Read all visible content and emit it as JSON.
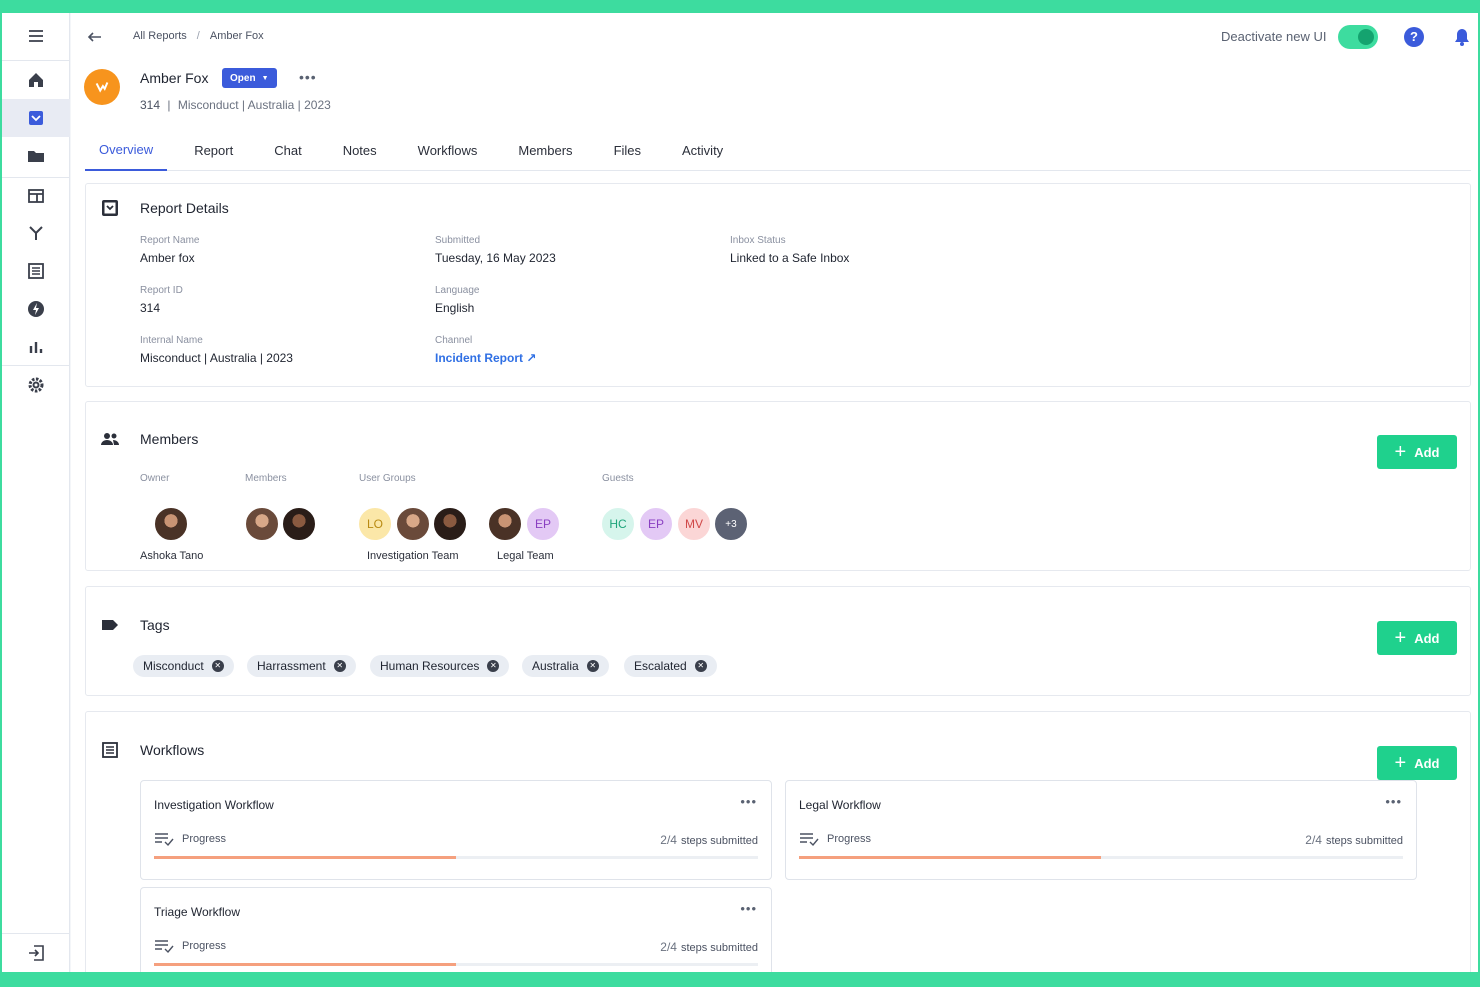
{
  "topbar": {
    "breadcrumb": [
      "All Reports",
      "Amber Fox"
    ],
    "deactivate_label": "Deactivate new UI",
    "help_label": "?"
  },
  "header": {
    "title": "Amber Fox",
    "status": "Open",
    "more": "•••",
    "sub_id": "314",
    "sub_text": "Misconduct  | Australia | 2023"
  },
  "tabs": [
    "Overview",
    "Report",
    "Chat",
    "Notes",
    "Workflows",
    "Members",
    "Files",
    "Activity"
  ],
  "report_details": {
    "title": "Report Details",
    "fields": {
      "report_name": {
        "label": "Report Name",
        "value": "Amber fox"
      },
      "report_id": {
        "label": "Report ID",
        "value": "314"
      },
      "internal_name": {
        "label": "Internal Name",
        "value": "Misconduct  | Australia | 2023"
      },
      "submitted": {
        "label": "Submitted",
        "value": "Tuesday, 16 May 2023"
      },
      "language": {
        "label": "Language",
        "value": "English"
      },
      "channel": {
        "label": "Channel",
        "value": "Incident Report ↗"
      },
      "inbox_status": {
        "label": "Inbox Status",
        "value": "Linked to a Safe Inbox"
      }
    }
  },
  "members": {
    "title": "Members",
    "add_label": "Add",
    "owner_label": "Owner",
    "owner_name": "Ashoka Tano",
    "members_label": "Members",
    "user_groups_label": "User Groups",
    "group_investigation": "Investigation Team",
    "group_legal": "Legal Team",
    "guests_label": "Guests",
    "initials": {
      "lo": "LO",
      "ep1": "EP",
      "hc": "HC",
      "ep2": "EP",
      "mv": "MV",
      "more": "+3"
    }
  },
  "tags": {
    "title": "Tags",
    "add_label": "Add",
    "items": [
      "Misconduct",
      "Harrassment",
      "Human Resources",
      "Australia",
      "Escalated"
    ]
  },
  "workflows": {
    "title": "Workflows",
    "add_label": "Add",
    "items": [
      {
        "title": "Investigation Workflow",
        "progress_label": "Progress",
        "fraction": "2/4",
        "steps_text": "steps submitted",
        "progress": 0.5
      },
      {
        "title": "Legal Workflow",
        "progress_label": "Progress",
        "fraction": "2/4",
        "steps_text": "steps submitted",
        "progress": 0.5
      },
      {
        "title": "Triage Workflow",
        "progress_label": "Progress",
        "fraction": "2/4",
        "steps_text": "steps submitted",
        "progress": 0.5
      }
    ]
  },
  "colors": {
    "accent": "#3b5bdb",
    "success": "#1fd18d",
    "frame": "#3ddc9f",
    "progress": "#f5a07e",
    "logo": "#f7941d"
  }
}
